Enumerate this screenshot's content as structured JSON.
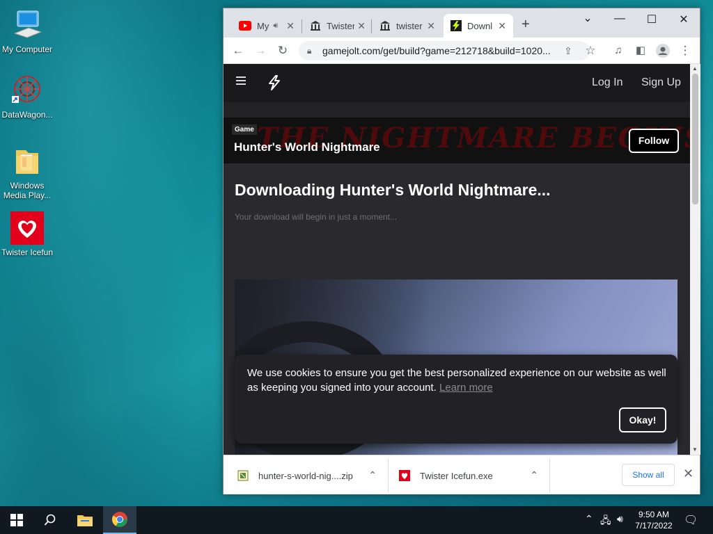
{
  "desktop": {
    "icons": [
      {
        "label": "My Computer"
      },
      {
        "label": "DataWagon..."
      },
      {
        "label": "Windows Media Play..."
      },
      {
        "label": "Twister Icefun"
      }
    ]
  },
  "browser": {
    "tabs": [
      {
        "title": "My",
        "icon": "youtube-icon",
        "audio": true
      },
      {
        "title": "Twister",
        "icon": "museum-icon"
      },
      {
        "title": "twister",
        "icon": "museum-icon"
      },
      {
        "title": "Downl",
        "icon": "gamejolt-icon",
        "active": true
      }
    ],
    "new_tab_symbol": "+",
    "url": "gamejolt.com/get/build?game=212718&build=1020..."
  },
  "page": {
    "nav": {
      "login": "Log In",
      "signup": "Sign Up"
    },
    "hero": {
      "tag": "Game",
      "title": "Hunter's World Nightmare",
      "bg_text": "THE NIGHTMARE BEGINS",
      "follow": "Follow"
    },
    "download_title": "Downloading Hunter's World Nightmare...",
    "download_subtitle": "Your download will begin in just a moment...",
    "cookie": {
      "text": "We use cookies to ensure you get the best personalized experience on our website as well as keeping you signed into your account.",
      "link": "Learn more",
      "button": "Okay!"
    }
  },
  "downloads": {
    "items": [
      {
        "name": "hunter-s-world-nig....zip",
        "icon": "zip-file-icon"
      },
      {
        "name": "Twister Icefun.exe",
        "icon": "exe-file-icon"
      }
    ],
    "show_all": "Show all"
  },
  "taskbar": {
    "time": "9:50 AM",
    "date": "7/17/2022"
  },
  "colors": {
    "accent_blue": "#1a73e8",
    "page_bg": "#2a2a2e",
    "gamejolt_green": "#ccff00"
  }
}
